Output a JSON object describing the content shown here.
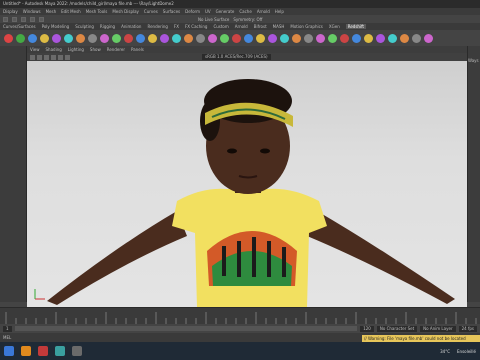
{
  "title": "Untitled* - Autodesk Maya 2022: /models/child_girl/maya file.mb --- \\Ray/LightDome2",
  "menubar": [
    "Display",
    "Windows",
    "Mesh",
    "Edit Mesh",
    "Mesh Tools",
    "Mesh Display",
    "Curves",
    "Surfaces",
    "Deform",
    "UV",
    "Generate",
    "Cache",
    "Arnold",
    "Help"
  ],
  "status": {
    "no_live": "No Live Surface",
    "symmetry": "Symmetry: Off"
  },
  "shelf_tabs": [
    "Curves/Surfaces",
    "Poly Modeling",
    "Sculpting",
    "Rigging",
    "Animation",
    "Rendering",
    "FX",
    "FX Caching",
    "Custom",
    "Arnold",
    "Bifrost",
    "MASH",
    "Motion Graphics",
    "XGen",
    "Redshift"
  ],
  "shelf_active": "Redshift",
  "viewport_menu": [
    "View",
    "Shading",
    "Lighting",
    "Show",
    "Renderer",
    "Panels"
  ],
  "gamma_label": "sRGB 1.0 ACES/Rec.709 (ACES)",
  "right_panel": {
    "label": "Ways"
  },
  "range": {
    "start": "1",
    "end": "120",
    "no_char": "No Character Set",
    "no_anim": "No Anim Layer",
    "fps": "24 fps"
  },
  "mel": "MEL",
  "warning": "// Warning: File 'maya file.mb' could not be located",
  "taskbar": {
    "temp": "34°C",
    "weather": "Ensoleillé"
  },
  "colors": {
    "shirt": "#f2e060",
    "skin": "#4a2c1e",
    "headband": "#c8b83a",
    "bg_top": "#cfcfcf"
  }
}
